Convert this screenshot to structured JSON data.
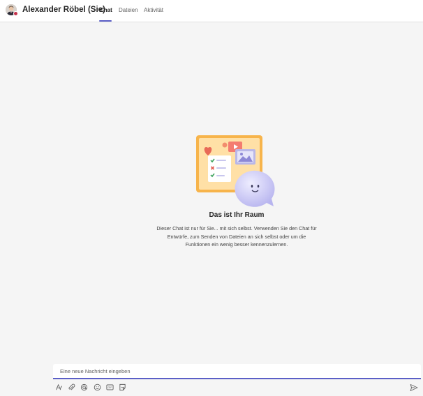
{
  "header": {
    "title": "Alexander Röbel (Sie)",
    "presence_color": "#c4314b",
    "tabs": [
      {
        "label": "Chat",
        "active": true
      },
      {
        "label": "Dateien",
        "active": false
      },
      {
        "label": "Aktivität",
        "active": false
      }
    ],
    "accent_color": "#5b5fc7"
  },
  "empty_state": {
    "title": "Das ist Ihr Raum",
    "description": "Dieser Chat ist nur für Sie... mit sich selbst. Verwenden Sie den Chat für Entwürfe, zum Senden von Dateien an sich selbst oder um die Funktionen ein wenig besser kennenzulernen."
  },
  "composer": {
    "placeholder": "Eine neue Nachricht eingeben",
    "value": ""
  },
  "toolbar": {
    "icons": [
      "format-icon",
      "attach-icon",
      "loop-icon",
      "emoji-icon",
      "gif-icon",
      "sticker-icon"
    ],
    "send_icon": "send-icon"
  }
}
